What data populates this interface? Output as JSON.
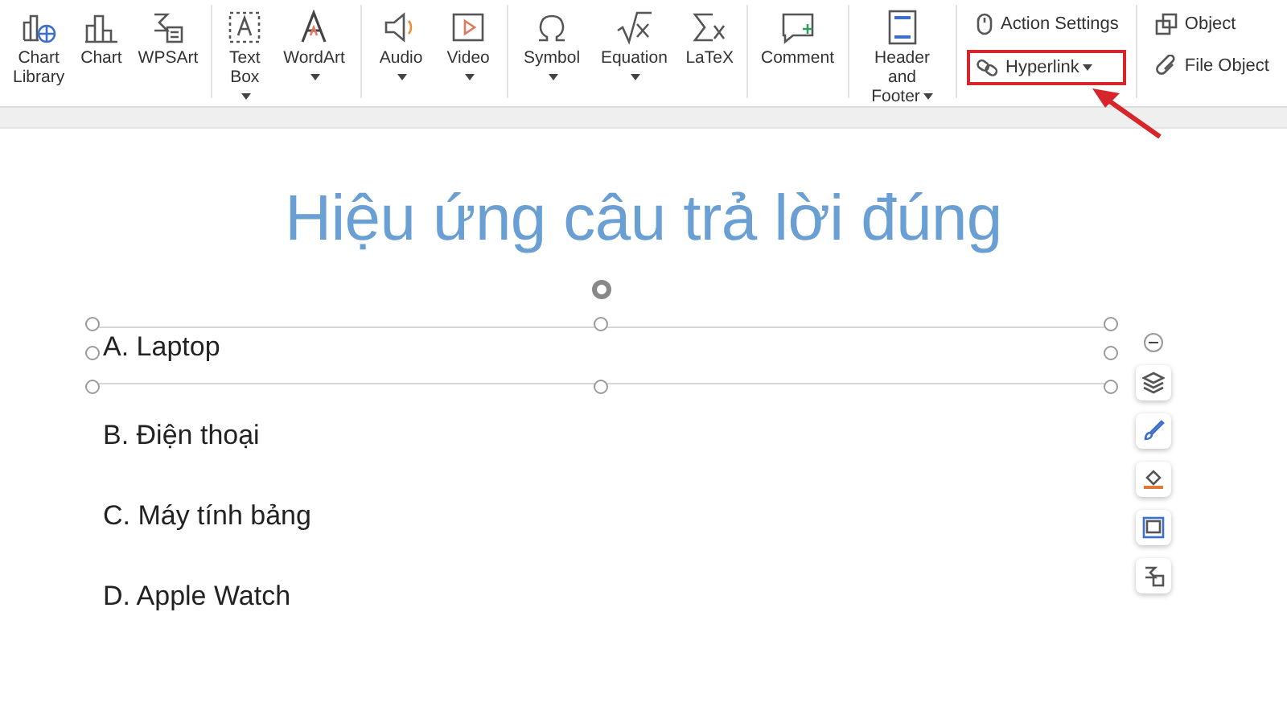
{
  "toolbar": {
    "groups": [
      {
        "kind": "large",
        "buttons": [
          {
            "label": "Chart\nLibrary",
            "dropdown": false,
            "highlighted": false
          },
          {
            "label": "Chart",
            "dropdown": false,
            "highlighted": false
          },
          {
            "label": "WPSArt",
            "dropdown": false,
            "highlighted": false
          }
        ]
      },
      {
        "kind": "large",
        "buttons": [
          {
            "label": "Text\nBox",
            "dropdown": true,
            "highlighted": false
          },
          {
            "label": "WordArt",
            "dropdown": true,
            "highlighted": false
          }
        ]
      },
      {
        "kind": "large",
        "buttons": [
          {
            "label": "Audio",
            "dropdown": true,
            "highlighted": false
          },
          {
            "label": "Video",
            "dropdown": true,
            "highlighted": false
          }
        ]
      },
      {
        "kind": "large",
        "buttons": [
          {
            "label": "Symbol",
            "dropdown": true,
            "highlighted": false
          },
          {
            "label": "Equation",
            "dropdown": true,
            "highlighted": false
          },
          {
            "label": "LaTeX",
            "dropdown": false,
            "highlighted": false
          }
        ]
      },
      {
        "kind": "large",
        "buttons": [
          {
            "label": "Comment",
            "dropdown": false,
            "highlighted": false
          }
        ]
      },
      {
        "kind": "large",
        "buttons": [
          {
            "label": "Header and\nFooter",
            "dropdown": true,
            "highlighted": false
          }
        ]
      },
      {
        "kind": "small",
        "buttons": [
          {
            "label": "Action Settings",
            "dropdown": false,
            "highlighted": false
          },
          {
            "label": "Hyperlink",
            "dropdown": true,
            "highlighted": true
          }
        ]
      },
      {
        "kind": "small",
        "buttons": [
          {
            "label": "Object",
            "dropdown": false,
            "highlighted": false
          },
          {
            "label": "File Object",
            "dropdown": false,
            "highlighted": false
          }
        ]
      }
    ]
  },
  "slide": {
    "title": "Hiệu ứng câu trả lời đúng",
    "answers": [
      {
        "text": "A. Laptop",
        "selected": true
      },
      {
        "text": "B. Điện thoại",
        "selected": false
      },
      {
        "text": "C. Máy tính bảng",
        "selected": false
      },
      {
        "text": "D. Apple Watch",
        "selected": false
      }
    ]
  }
}
